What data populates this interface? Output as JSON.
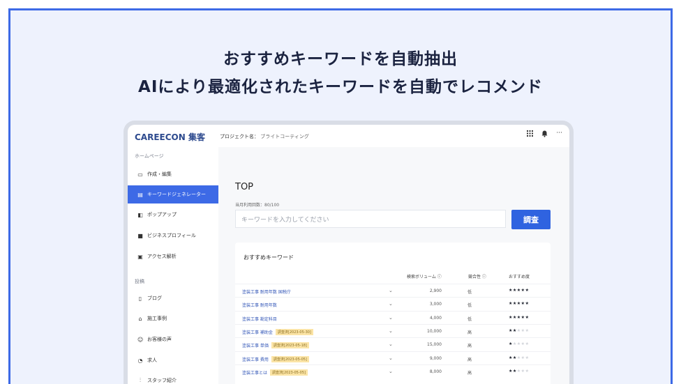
{
  "headline": {
    "line1": "おすすめキーワードを自動抽出",
    "line2": "AIにより最適化されたキーワードを自動でレコメンド"
  },
  "app": {
    "logo": "CAREECON",
    "logo_suffix": "集客",
    "project_label": "プロジェクト名：",
    "project_value": "ブライトコーティング",
    "top_icons": [
      "grid-icon",
      "bell-icon",
      "more-icon"
    ]
  },
  "sidebar": {
    "home_section": "ホームページ",
    "items": [
      {
        "label": "作成・編集",
        "icon": "monitor-icon"
      },
      {
        "label": "キーワードジェネレーター",
        "icon": "document-icon",
        "active": true
      },
      {
        "label": "ポップアップ",
        "icon": "popup-icon"
      },
      {
        "label": "ビジネスプロフィール",
        "icon": "store-icon"
      },
      {
        "label": "アクセス解析",
        "icon": "analytics-icon"
      }
    ],
    "post_section": "投稿",
    "post_items": [
      {
        "label": "ブログ",
        "icon": "blog-icon"
      },
      {
        "label": "施工事例",
        "icon": "house-icon"
      },
      {
        "label": "お客様の声",
        "icon": "people-icon"
      },
      {
        "label": "求人",
        "icon": "job-icon"
      },
      {
        "label": "スタッフ紹介",
        "icon": "staff-icon"
      }
    ]
  },
  "main": {
    "title": "TOP",
    "usage": "当月利用回数：80/100",
    "search_placeholder": "キーワードを入力してください",
    "search_button": "調査",
    "card_title": "おすすめキーワード",
    "columns": {
      "volume": "検索ボリューム ⓘ",
      "competition": "競合性 ⓘ",
      "recommend": "おすすめ度"
    },
    "rows": [
      {
        "keyword": "塗装工事 耐用年数 国税庁",
        "tag": "",
        "volume": "2,900",
        "competition": "低",
        "stars": 5
      },
      {
        "keyword": "塗装工事 耐用年数",
        "tag": "",
        "volume": "3,000",
        "competition": "低",
        "stars": 5
      },
      {
        "keyword": "塗装工事 勘定科目",
        "tag": "",
        "volume": "4,000",
        "competition": "低",
        "stars": 5
      },
      {
        "keyword": "塗装工事 補助金",
        "tag": "調査済[2023-05-30]",
        "volume": "10,000",
        "competition": "高",
        "stars": 2
      },
      {
        "keyword": "塗装工事 単価",
        "tag": "調査済[2023-05-18]",
        "volume": "15,000",
        "competition": "高",
        "stars": 1
      },
      {
        "keyword": "塗装工事 費用",
        "tag": "調査済[2023-05-05]",
        "volume": "9,000",
        "competition": "高",
        "stars": 2
      },
      {
        "keyword": "塗装工事とは",
        "tag": "調査済[2023-05-05]",
        "volume": "8,000",
        "competition": "高",
        "stars": 2
      }
    ]
  },
  "colors": {
    "frame": "#3d6ae6",
    "background": "#eef2fd",
    "accent": "#2f63e0",
    "tag": "#fbe4a6"
  }
}
